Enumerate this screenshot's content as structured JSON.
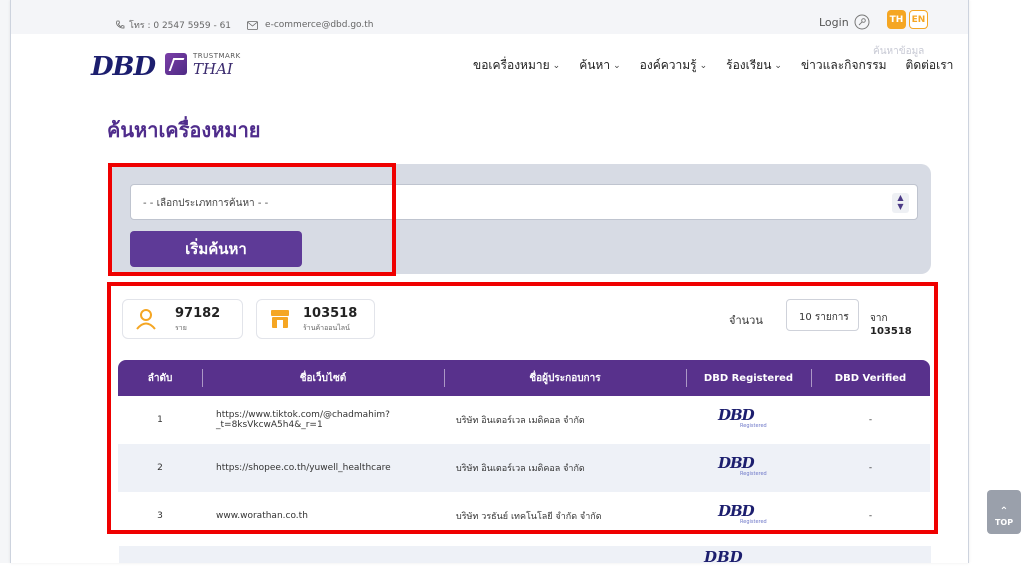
{
  "topbar": {
    "phone": "โทร : 0 2547 5959 - 61",
    "email": "e-commerce@dbd.go.th",
    "login_label": "Login",
    "lang_th": "TH",
    "lang_en": "EN"
  },
  "logo": {
    "dbd_text": "DBD",
    "trustmark_small": "TRUSTMARK",
    "trustmark_big": "THAI"
  },
  "nav": {
    "items": [
      {
        "label": "ขอเครื่องหมาย"
      },
      {
        "label": "ค้นหา"
      },
      {
        "label": "องค์ความรู้"
      },
      {
        "label": "ร้องเรียน"
      },
      {
        "label": "ข่าวและกิจกรรม"
      },
      {
        "label": "ติดต่อเรา"
      }
    ],
    "search_ghost": "ค้นหาข้อมูล"
  },
  "page": {
    "title": "ค้นหาเครื่องหมาย"
  },
  "search": {
    "select_placeholder": "- - เลือกประเภทการค้นหา - -",
    "button_label": "เริ่มค้นหา"
  },
  "stats": {
    "users_count": "97182",
    "users_label": "ราย",
    "shops_count": "103518",
    "shops_label": "ร้านค้าออนไลน์"
  },
  "paging": {
    "page_size_label": "จำนวน",
    "page_size_value": "10 รายการ",
    "total_prefix": "จาก",
    "total_value": "103518"
  },
  "table": {
    "headers": [
      "ลำดับ",
      "ชื่อเว็บไซต์",
      "ชื่อผู้ประกอบการ",
      "DBD Registered",
      "DBD Verified"
    ],
    "rows": [
      {
        "no": "1",
        "website": "https://www.tiktok.com/@chadmahim?_t=8ksVkcwA5h4&_r=1",
        "operator": "บริษัท อินเตอร์เวล เมดิคอล จำกัด",
        "registered_badge": "DBD",
        "registered_sub": "Registered",
        "verified": "-"
      },
      {
        "no": "2",
        "website": "https://shopee.co.th/yuwell_healthcare",
        "operator": "บริษัท อินเตอร์เวล เมดิคอล จำกัด",
        "registered_badge": "DBD",
        "registered_sub": "Registered",
        "verified": "-"
      },
      {
        "no": "3",
        "website": "www.worathan.co.th",
        "operator": "บริษัท วรธันย์ เทคโนโลยี จำกัด จำกัด",
        "registered_badge": "DBD",
        "registered_sub": "Registered",
        "verified": "-"
      }
    ],
    "next_badge": "DBD"
  },
  "top_button": {
    "label": "TOP"
  },
  "colors": {
    "brand_purple": "#58318c",
    "accent_orange": "#f5a623",
    "highlight_red": "#ef0000"
  }
}
